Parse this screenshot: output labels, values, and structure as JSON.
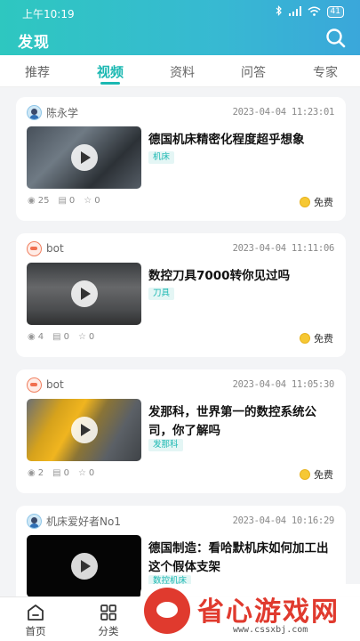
{
  "status": {
    "time": "上午10:19",
    "battery": "41"
  },
  "header": {
    "title": "发现"
  },
  "tabs": [
    {
      "label": "推荐",
      "active": false
    },
    {
      "label": "视频",
      "active": true
    },
    {
      "label": "资料",
      "active": false
    },
    {
      "label": "问答",
      "active": false
    },
    {
      "label": "专家",
      "active": false
    }
  ],
  "cards": [
    {
      "author": "陈永学",
      "avatar": "person-avatar",
      "time": "2023-04-04 11:23:01",
      "title": "德国机床精密化程度超乎想象",
      "tag": "机床",
      "views": "25",
      "docs": "0",
      "stars": "0",
      "price": "免费"
    },
    {
      "author": "bot",
      "avatar": "bot-avatar",
      "time": "2023-04-04 11:11:06",
      "title": "数控刀具7000转你见过吗",
      "tag": "刀具",
      "views": "4",
      "docs": "0",
      "stars": "0",
      "price": "免费"
    },
    {
      "author": "bot",
      "avatar": "bot-avatar",
      "time": "2023-04-04 11:05:30",
      "title": "发那科，世界第一的数控系统公司，你了解吗",
      "tag": "发那科",
      "views": "2",
      "docs": "0",
      "stars": "0",
      "price": "免费"
    },
    {
      "author": "机床爱好者No1",
      "avatar": "person-avatar",
      "time": "2023-04-04 10:16:29",
      "title": "德国制造：看哈默机床如何加工出这个假体支架",
      "tag": "数控机床"
    }
  ],
  "bottom_nav": [
    {
      "label": "首页",
      "icon": "home-icon"
    },
    {
      "label": "分类",
      "icon": "grid-icon"
    }
  ],
  "watermark": {
    "text": "省心游戏网",
    "url": "www.cssxbj.com"
  },
  "colors": {
    "accent": "#1bb8b2",
    "header_start": "#2ec7c0",
    "header_end": "#3aa7da",
    "coin": "#f6c834"
  }
}
